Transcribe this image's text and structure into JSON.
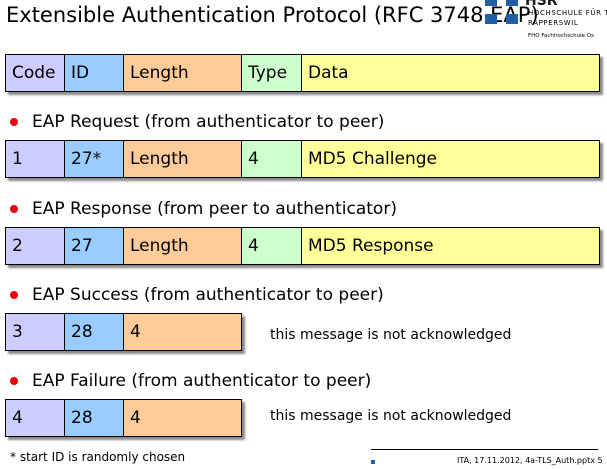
{
  "title": "Extensible Authentication Protocol (RFC 3748 EAP)",
  "logo": {
    "brand": "HSR",
    "line1": "HOCHSCHULE FÜR T",
    "line2": "RAPPERSWIL",
    "line3": "FHO Fachhochschule Os"
  },
  "header_row": {
    "code": "Code",
    "id": "ID",
    "length": "Length",
    "type": "Type",
    "data": "Data"
  },
  "request": {
    "heading": "EAP Request (from authenticator to peer)",
    "code": "1",
    "id": "27*",
    "length": "Length",
    "type": "4",
    "data": "MD5 Challenge"
  },
  "response": {
    "heading": "EAP Response (from peer to authenticator)",
    "code": "2",
    "id": "27",
    "length": "Length",
    "type": "4",
    "data": "MD5 Response"
  },
  "success": {
    "heading": "EAP Success (from authenticator to peer)",
    "code": "3",
    "id": "28",
    "length": "4",
    "note": "this message is not acknowledged"
  },
  "failure": {
    "heading": "EAP Failure (from authenticator to peer)",
    "code": "4",
    "id": "28",
    "length": "4",
    "note": "this message is not acknowledged"
  },
  "footnote": "* start ID is randomly chosen",
  "footer": "ITA, 17.11.2012, 4a-TLS_Auth.pptx 5",
  "colors": {
    "code": "#ccccff",
    "id": "#99ccff",
    "length": "#ffcc99",
    "type": "#ccffcc",
    "data": "#ffff99",
    "bullet": "#e8000f",
    "logo": "#1f5fa6"
  }
}
